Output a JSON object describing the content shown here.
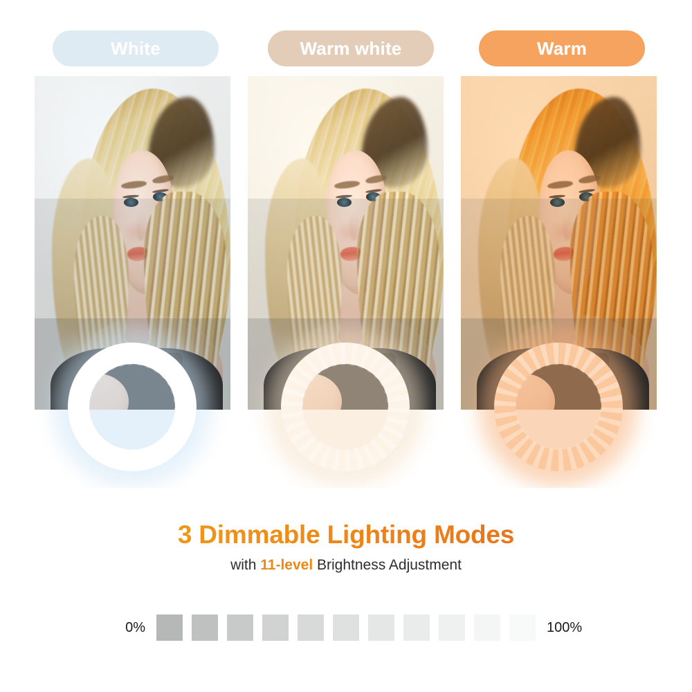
{
  "modes": [
    {
      "label": "White",
      "pill_bg": "#dfebf3",
      "ring_color": "#ffffff",
      "glow": "#cfe6f7"
    },
    {
      "label": "Warm white",
      "pill_bg": "#e3cdb8",
      "ring_color": "#fdf3e6",
      "glow": "#f6e2c8"
    },
    {
      "label": "Warm",
      "pill_bg": "#f5a35e",
      "ring_color": "#fbc79c",
      "glow": "#f7b47f"
    }
  ],
  "headline": "3 Dimmable Lighting Modes",
  "subhead": {
    "prefix": "with ",
    "accent": "11-level",
    "suffix": " Brightness Adjustment"
  },
  "brightness_scale": {
    "min_label": "0%",
    "max_label": "100%",
    "levels": 11,
    "swatch_colors": [
      "#b6b7b7",
      "#bfc0c0",
      "#c8c9c9",
      "#d1d2d2",
      "#d8d9d9",
      "#dfe0e0",
      "#e5e6e6",
      "#eaebeb",
      "#eff0f0",
      "#f4f5f5",
      "#f8f9f9"
    ]
  },
  "colors": {
    "headline_gradient_start": "#f0a81e",
    "headline_gradient_end": "#e5621c",
    "accent": "#e8891a",
    "background": "#ffffff"
  }
}
